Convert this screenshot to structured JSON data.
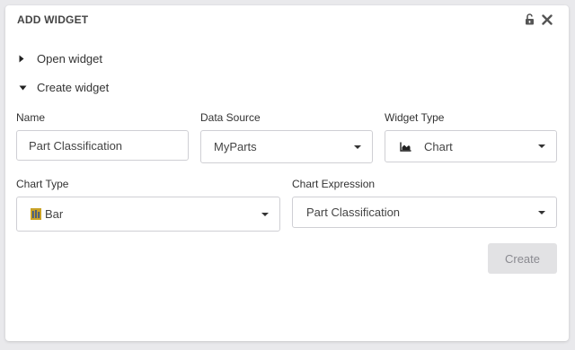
{
  "dialog": {
    "title": "ADD WIDGET",
    "lock_icon": "unlock-icon",
    "close_icon": "close-icon"
  },
  "tree": {
    "open_widget": {
      "label": "Open widget",
      "state": "collapsed"
    },
    "create_widget": {
      "label": "Create widget",
      "state": "expanded"
    }
  },
  "form": {
    "name": {
      "label": "Name",
      "value": "Part Classification"
    },
    "data_source": {
      "label": "Data Source",
      "value": "MyParts"
    },
    "widget_type": {
      "label": "Widget Type",
      "value": "Chart",
      "icon": "area-chart-icon"
    },
    "chart_type": {
      "label": "Chart Type",
      "value": "Bar",
      "icon": "bar-chart-icon"
    },
    "chart_expression": {
      "label": "Chart Expression",
      "value": "Part Classification"
    }
  },
  "actions": {
    "create_label": "Create",
    "create_enabled": false
  },
  "colors": {
    "background": "#e9e9ec",
    "panel": "#ffffff",
    "border": "#cfcfd4",
    "disabled_button": "#e2e2e4",
    "disabled_text": "#8a8a90",
    "bar_icon_gold": "#c9a227",
    "bar_icon_blue": "#2f4f8f"
  }
}
